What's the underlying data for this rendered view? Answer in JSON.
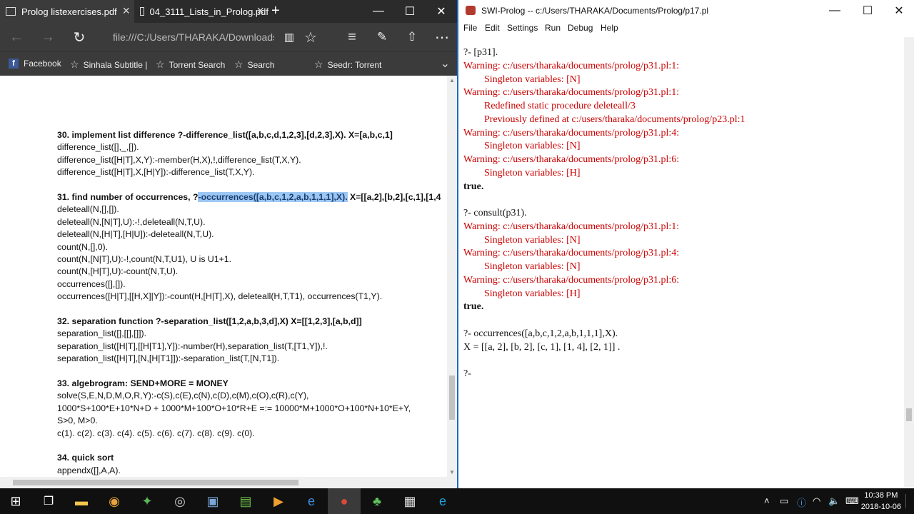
{
  "edge": {
    "tabs": [
      {
        "title": "Prolog listexercises.pdf",
        "active": true
      },
      {
        "title": "04_3111_Lists_in_Prolog.pdf",
        "active": false
      }
    ],
    "new_tab": "+",
    "window_controls": {
      "minimize": "—",
      "maximize": "☐",
      "close": "✕"
    },
    "address": "file:///C:/Users/THARAKA/Downloads/Dc",
    "favorites": [
      "Facebook",
      "Sinhala Subtitle |",
      "Torrent Search",
      "Search",
      "Seedr: Torrent"
    ],
    "document": [
      {
        "text": "30. implement list difference ?-difference_list([a,b,c,d,1,2,3],[d,2,3],X). X=[a,b,c,1]",
        "head": true
      },
      {
        "text": "difference_list([],_,[])."
      },
      {
        "text": "difference_list([H|T],X,Y):-member(H,X),!,difference_list(T,X,Y)."
      },
      {
        "text": "difference_list([H|T],X,[H|Y]):-difference_list(T,X,Y)."
      },
      {
        "text": ""
      },
      {
        "text": "",
        "head": true,
        "parts": {
          "before": "31. find number of occurrences, ?",
          "highlight": "-occurrences([a,b,c,1,2,a,b,1,1,1],X).",
          "after": " X=[[a,2],[b,2],[c,1],[1,4"
        }
      },
      {
        "text": "deleteall(N,[],[])."
      },
      {
        "text": "deleteall(N,[N|T],U):-!,deleteall(N,T,U)."
      },
      {
        "text": "deleteall(N,[H|T],[H|U]):-deleteall(N,T,U)."
      },
      {
        "text": "count(N,[],0)."
      },
      {
        "text": "count(N,[N|T],U):-!,count(N,T,U1), U is U1+1."
      },
      {
        "text": "count(N,[H|T],U):-count(N,T,U)."
      },
      {
        "text": "occurrences([],[])."
      },
      {
        "text": "occurrences([H|T],[[H,X]|Y]):-count(H,[H|T],X), deleteall(H,T,T1), occurrences(T1,Y)."
      },
      {
        "text": ""
      },
      {
        "text": "32. separation function ?-separation_list([1,2,a,b,3,d],X) X=[[1,2,3],[a,b,d]]",
        "head": true
      },
      {
        "text": "separation_list([],[[],[]])."
      },
      {
        "text": "separation_list([H|T],[[H|T1],Y]):-number(H),separation_list(T,[T1,Y]),!."
      },
      {
        "text": "separation_list([H|T],[N,[H|T1]]):-separation_list(T,[N,T1])."
      },
      {
        "text": ""
      },
      {
        "text": "33. algebrogram: SEND+MORE = MONEY",
        "head": true
      },
      {
        "text": "solve(S,E,N,D,M,O,R,Y):-c(S),c(E),c(N),c(D),c(M),c(O),c(R),c(Y),"
      },
      {
        "text": "1000*S+100*E+10*N+D + 1000*M+100*O+10*R+E =:= 10000*M+1000*O+100*N+10*E+Y,"
      },
      {
        "text": "S>0, M>0."
      },
      {
        "text": "c(1). c(2). c(3). c(4). c(5). c(6). c(7). c(8). c(9). c(0)."
      },
      {
        "text": ""
      },
      {
        "text": "34. quick sort",
        "head": true
      },
      {
        "text": "appendx([],A,A)."
      }
    ]
  },
  "swi": {
    "title": "SWI-Prolog -- c:/Users/THARAKA/Documents/Prolog/p17.pl",
    "menu": [
      "File",
      "Edit",
      "Settings",
      "Run",
      "Debug",
      "Help"
    ],
    "console": [
      {
        "text": "?- [p31].",
        "type": "normal",
        "indent": false
      },
      {
        "text": "Warning: c:/users/tharaka/documents/prolog/p31.pl:1:",
        "type": "warn",
        "indent": false
      },
      {
        "text": "Singleton variables: [N]",
        "type": "warn",
        "indent": true
      },
      {
        "text": "Warning: c:/users/tharaka/documents/prolog/p31.pl:1:",
        "type": "warn",
        "indent": false
      },
      {
        "text": "Redefined static procedure deleteall/3",
        "type": "warn",
        "indent": true
      },
      {
        "text": "Previously defined at c:/users/tharaka/documents/prolog/p23.pl:1",
        "type": "warn",
        "indent": true
      },
      {
        "text": "Warning: c:/users/tharaka/documents/prolog/p31.pl:4:",
        "type": "warn",
        "indent": false
      },
      {
        "text": "Singleton variables: [N]",
        "type": "warn",
        "indent": true
      },
      {
        "text": "Warning: c:/users/tharaka/documents/prolog/p31.pl:6:",
        "type": "warn",
        "indent": false
      },
      {
        "text": "Singleton variables: [H]",
        "type": "warn",
        "indent": true
      },
      {
        "text": "true.",
        "type": "bold",
        "indent": false
      },
      {
        "text": "",
        "type": "normal",
        "indent": false
      },
      {
        "text": "?- consult(p31).",
        "type": "normal",
        "indent": false
      },
      {
        "text": "Warning: c:/users/tharaka/documents/prolog/p31.pl:1:",
        "type": "warn",
        "indent": false
      },
      {
        "text": "Singleton variables: [N]",
        "type": "warn",
        "indent": true
      },
      {
        "text": "Warning: c:/users/tharaka/documents/prolog/p31.pl:4:",
        "type": "warn",
        "indent": false
      },
      {
        "text": "Singleton variables: [N]",
        "type": "warn",
        "indent": true
      },
      {
        "text": "Warning: c:/users/tharaka/documents/prolog/p31.pl:6:",
        "type": "warn",
        "indent": false
      },
      {
        "text": "Singleton variables: [H]",
        "type": "warn",
        "indent": true
      },
      {
        "text": "true.",
        "type": "bold",
        "indent": false
      },
      {
        "text": "",
        "type": "normal",
        "indent": false
      },
      {
        "text": "?- occurrences([a,b,c,1,2,a,b,1,1,1],X).",
        "type": "normal",
        "indent": false
      },
      {
        "text": "X = [[a, 2], [b, 2], [c, 1], [1, 4], [2, 1]] .",
        "type": "normal",
        "indent": false
      },
      {
        "text": "",
        "type": "normal",
        "indent": false
      },
      {
        "text": "?-",
        "type": "normal",
        "indent": false
      }
    ]
  },
  "taskbar": {
    "time": "10:38 PM",
    "date": "2018-10-06"
  },
  "colors": {
    "warning": "#cc0000",
    "highlight": "#9cc7f4",
    "accent": "#1a6bc7"
  }
}
